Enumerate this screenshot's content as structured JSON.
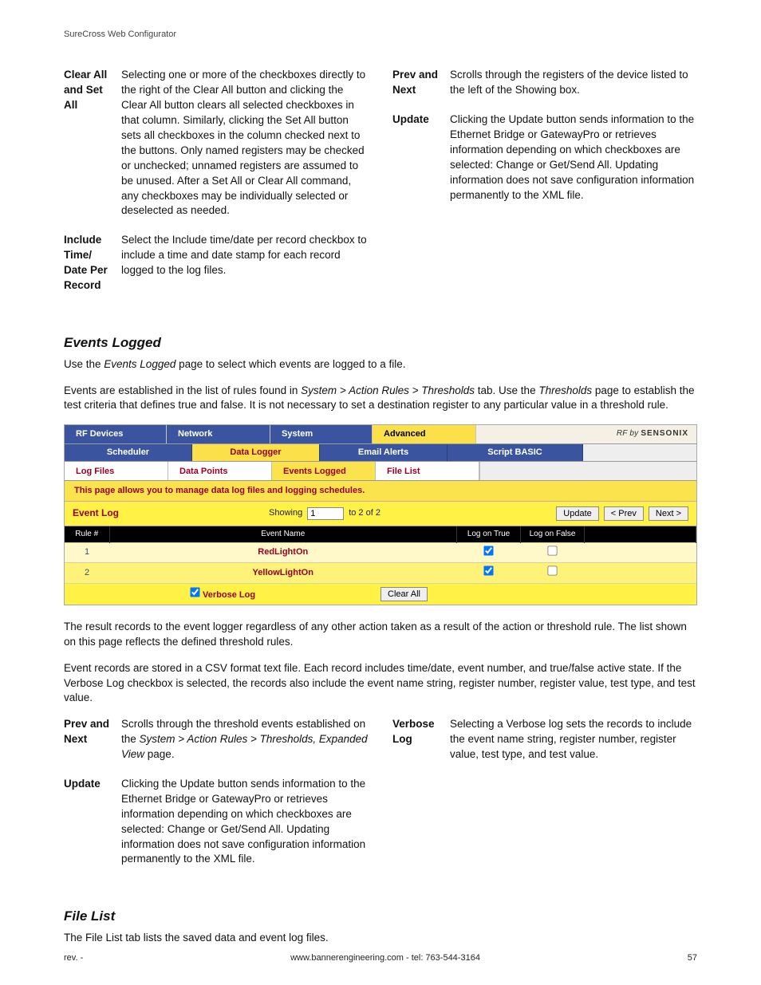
{
  "header": {
    "title": "SureCross Web Configurator"
  },
  "top_defs_left": [
    {
      "term": "Clear All and Set All",
      "desc": "Selecting one or more of the checkboxes directly to the right of the Clear All button and clicking the Clear All button clears all selected checkboxes in that column. Similarly, clicking the Set All button sets all checkboxes in the column checked next to the buttons. Only named registers may be checked or unchecked; unnamed registers are assumed to be unused. After a Set All or Clear All command, any checkboxes may be individually selected or deselected as needed."
    },
    {
      "term": "Include Time/ Date Per Record",
      "desc": "Select the Include time/date per record checkbox to include a time and date stamp for each record logged to the log files."
    }
  ],
  "top_defs_right": [
    {
      "term": "Prev and Next",
      "desc": "Scrolls through the registers of the device listed to the left of the Showing box."
    },
    {
      "term": "Update",
      "desc": "Clicking the Update button sends information to the Ethernet Bridge or GatewayPro or retrieves information depending on which checkboxes are selected: Change or Get/Send All. Updating information does not save configuration information permanently to the XML file."
    }
  ],
  "section1": {
    "title": "Events Logged",
    "intro1_pre": "Use the ",
    "intro1_em": "Events Logged",
    "intro1_post": " page to select which events are logged to a file.",
    "intro2_a": "Events are established in the list of rules found in ",
    "intro2_path": "System > Action Rules > Thresholds",
    "intro2_b": " tab. Use the ",
    "intro2_em2": "Thresholds",
    "intro2_c": " page to establish the test criteria that defines true and false. It is not necessary to set a destination register to any particular value in a threshold rule."
  },
  "ui": {
    "tabs1": {
      "rf": "RF Devices",
      "network": "Network",
      "system": "System",
      "advanced": "Advanced"
    },
    "brand_prefix": "RF by ",
    "brand_name": "SENSONIX",
    "tabs2": {
      "scheduler": "Scheduler",
      "data_logger": "Data Logger",
      "email_alerts": "Email Alerts",
      "script_basic": "Script BASIC"
    },
    "tabs3": {
      "log_files": "Log Files",
      "data_points": "Data Points",
      "events_logged": "Events Logged",
      "file_list": "File List"
    },
    "band_msg": "This page allows you to manage data log files and logging schedules.",
    "event_log_title": "Event Log",
    "showing_label": "Showing",
    "showing_value": "1",
    "showing_suffix": "to 2 of 2",
    "buttons": {
      "update": "Update",
      "prev": "< Prev",
      "next": "Next >",
      "clear_all": "Clear All"
    },
    "table": {
      "headers": {
        "rule": "Rule #",
        "name": "Event Name",
        "log_true": "Log on True",
        "log_false": "Log on False"
      },
      "rows": [
        {
          "rule": "1",
          "name": "RedLightOn",
          "log_true": true,
          "log_false": false
        },
        {
          "rule": "2",
          "name": "YellowLightOn",
          "log_true": true,
          "log_false": false
        }
      ]
    },
    "verbose_label": "Verbose Log",
    "verbose_checked": true
  },
  "after_shot": {
    "p1": "The result records to the event logger regardless of any other action taken as a result of the action or threshold rule. The list shown on this page reflects the defined threshold rules.",
    "p2": "Event records are stored in a CSV format text file. Each record includes time/date, event number, and true/false active state. If the Verbose Log checkbox is selected, the records also include the event name string, register number, register value, test type, and test value."
  },
  "lower_defs_left": [
    {
      "term": "Prev and Next",
      "desc_pre": "Scrolls through the threshold events established on the ",
      "desc_em": "System > Action Rules > Thresholds, Expanded View",
      "desc_post": " page."
    },
    {
      "term": "Update",
      "desc_pre": "Clicking the Update button sends information to the Ethernet Bridge or GatewayPro or retrieves information depending on which checkboxes are selected: Change or Get/Send All. Updating information does not save configuration information permanently to the XML file.",
      "desc_em": "",
      "desc_post": ""
    }
  ],
  "lower_defs_right": [
    {
      "term": "Verbose Log",
      "desc": "Selecting a Verbose log sets the records to include the event name string, register number, register value, test type, and test value."
    }
  ],
  "section2": {
    "title": "File List",
    "intro": "The File List tab lists the saved data and event log files."
  },
  "footer": {
    "left": "rev. -",
    "center": "www.bannerengineering.com - tel: 763-544-3164",
    "right": "57"
  }
}
